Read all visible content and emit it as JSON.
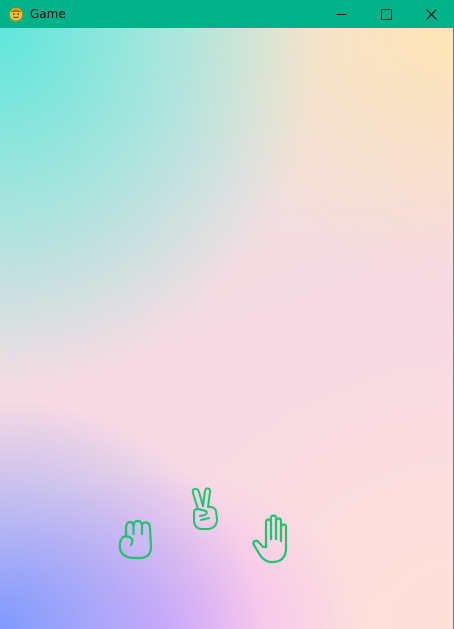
{
  "window": {
    "title": "Game",
    "app_icon": "smiley-emoji-icon",
    "controls": [
      "minimize-icon",
      "maximize-icon",
      "close-icon"
    ]
  },
  "game": {
    "choices": [
      {
        "id": "rock",
        "icon": "fist-hand-icon"
      },
      {
        "id": "scissors",
        "icon": "victory-hand-icon"
      },
      {
        "id": "paper",
        "icon": "open-hand-icon"
      }
    ],
    "hand_color": "#22c270",
    "titlebar_color": "#00b189"
  }
}
